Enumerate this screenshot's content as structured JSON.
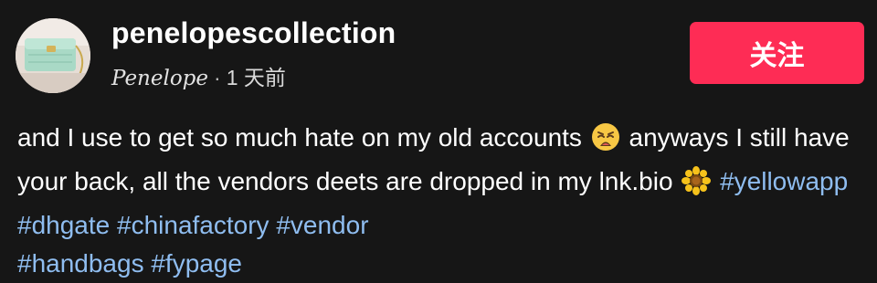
{
  "post": {
    "username": "penelopescollection",
    "display_name": "Penelope",
    "separator": "·",
    "time_ago": "1 天前",
    "follow_label": "关注",
    "caption": {
      "text_line_1": "and I use to get so much hate on my old accounts",
      "emoji_1": "weary-face-emoji",
      "text_line_1b": "anyways I still have your back, all the vendors deets are dropped in my lnk.bio",
      "emoji_2": "sunflower-emoji",
      "hashtags": [
        "#yellowapp",
        "#dhgate",
        "#chinafactory",
        "#vendor",
        "#handbags",
        "#fypage"
      ]
    }
  },
  "colors": {
    "background": "#161616",
    "follow_button": "#fe2c55",
    "hashtag": "#8fbdf0",
    "text": "#ffffff"
  },
  "icons": {
    "avatar": "handbag-photo-avatar"
  }
}
